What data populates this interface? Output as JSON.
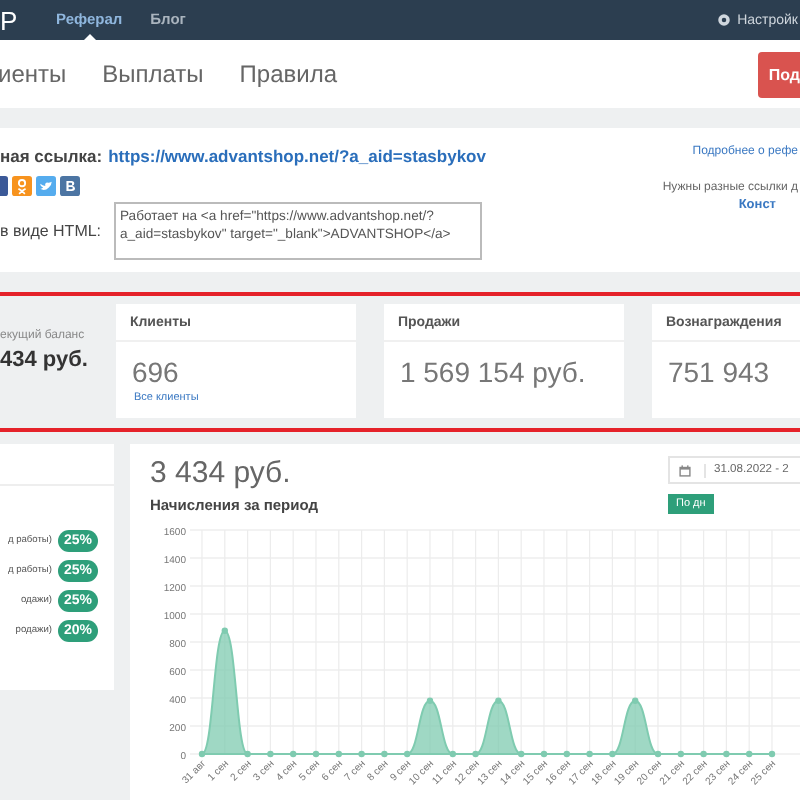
{
  "topnav": {
    "logo_letter": "P",
    "items": [
      {
        "label": "Реферал",
        "selected": true
      },
      {
        "label": "Блог",
        "selected": false
      }
    ],
    "settings": "Настройк"
  },
  "subnav": {
    "tabs": [
      "иенты",
      "Выплаты",
      "Правила"
    ],
    "button": "Под"
  },
  "link_panel": {
    "link_label": "ная ссылка:",
    "link": "https://www.advantshop.net/?a_aid=stasbykov",
    "html_label": "в виде HTML:",
    "html_code": "Работает на <a href=\"https://www.advantshop.net/?a_aid=stasbykov\" target=\"_blank\">ADVANTSHOP</a>",
    "more_link": "Подробнее о рефе",
    "hint": "Нужны разные ссылки д",
    "constructor_link": "Конст"
  },
  "balance": {
    "label": "екущий баланс",
    "value": "434 руб."
  },
  "stat_cards": [
    {
      "title": "Клиенты",
      "value": "696",
      "link": "Все клиенты"
    },
    {
      "title": "Продажи",
      "value": "1 569 154 руб."
    },
    {
      "title": "Вознаграждения",
      "value": "751 943"
    }
  ],
  "commission_rates": [
    {
      "label": "д работы)",
      "rate": "25%"
    },
    {
      "label": "д работы)",
      "rate": "25%"
    },
    {
      "label": "одажи)",
      "rate": "25%"
    },
    {
      "label": "родажи)",
      "rate": "20%"
    }
  ],
  "earnings": {
    "total": "3 434 руб.",
    "title": "Начисления за период",
    "date_range": "31.08.2022 - 2",
    "group_button": "По дн",
    "chart_data": {
      "type": "area",
      "categories": [
        "31 авг",
        "1 сен",
        "2 сен",
        "3 сен",
        "4 сен",
        "5 сен",
        "6 сен",
        "7 сен",
        "8 сен",
        "9 сен",
        "10 сен",
        "11 сен",
        "12 сен",
        "13 сен",
        "14 сен",
        "15 сен",
        "16 сен",
        "17 сен",
        "18 сен",
        "19 сен",
        "20 сен",
        "21 сен",
        "22 сен",
        "23 сен",
        "24 сен",
        "25 сен"
      ],
      "grid": true,
      "series": [
        {
          "color": "#7fcbb0",
          "values": [
            0,
            880,
            0,
            0,
            0,
            0,
            0,
            0,
            0,
            0,
            380,
            0,
            0,
            380,
            0,
            0,
            0,
            0,
            0,
            380,
            0,
            0,
            0,
            0,
            0,
            0
          ]
        }
      ],
      "ylim": [
        0,
        1600
      ],
      "yticks": [
        0,
        200,
        400,
        600,
        800,
        1000,
        1200,
        1400,
        1600
      ]
    }
  }
}
